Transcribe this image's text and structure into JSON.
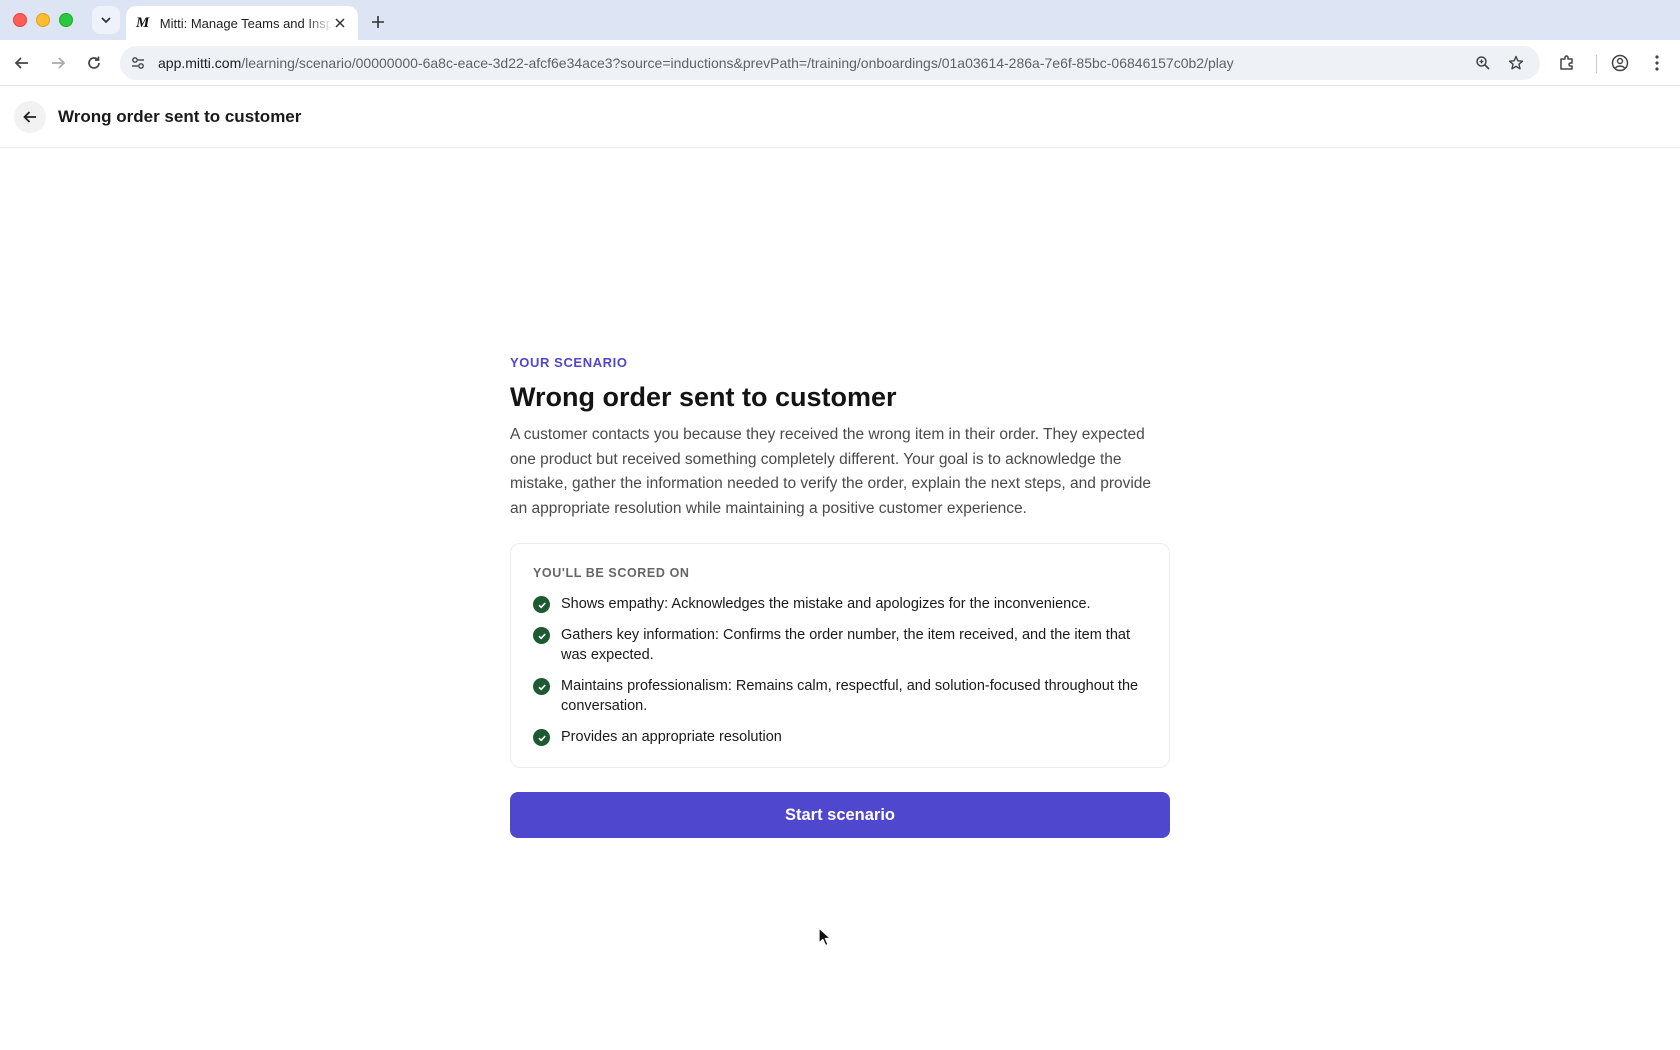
{
  "browser": {
    "tab_title": "Mitti: Manage Teams and Inspections",
    "tab_favicon": "M",
    "url_host": "app.mitti.com",
    "url_path": "/learning/scenario/00000000-6a8c-eace-3d22-afcf6e34ace3?source=inductions&prevPath=/training/onboardings/01a03614-286a-7e6f-85bc-06846157c0b2/play"
  },
  "header": {
    "title": "Wrong order sent to customer"
  },
  "scenario": {
    "eyebrow": "YOUR SCENARIO",
    "title": "Wrong order sent to customer",
    "description": "A customer contacts you because they received the wrong item in their order. They expected one product but received something completely different. Your goal is to acknowledge the mistake, gather the information needed to verify the order, explain the next steps, and provide an appropriate resolution while maintaining a positive customer experience.",
    "scored_heading": "YOU'LL BE SCORED ON",
    "criteria": [
      "Shows empathy: Acknowledges the mistake and apologizes for the inconvenience.",
      "Gathers key information: Confirms the order number, the item received, and the item that was expected.",
      "Maintains professionalism: Remains calm, respectful, and solution-focused throughout the conversation.",
      "Provides an appropriate resolution"
    ],
    "start_label": "Start scenario"
  },
  "colors": {
    "accent": "#4f47ce",
    "check": "#1d5a32",
    "eyebrow": "#4f46c8"
  }
}
